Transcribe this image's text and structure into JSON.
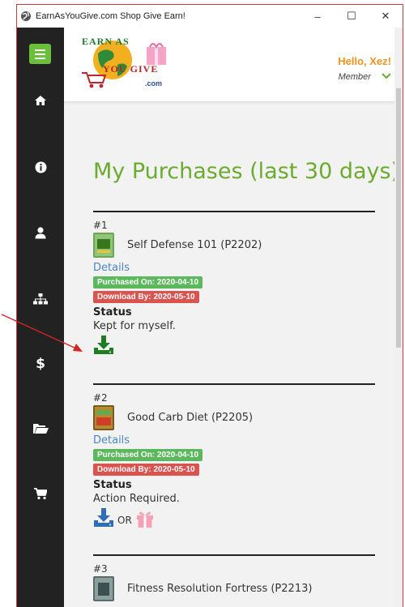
{
  "window": {
    "title": "EarnAsYouGive.com Shop Give Earn!",
    "minimize": "–",
    "maximize": "☐",
    "close": "✕"
  },
  "header": {
    "logo_line1": "EARN AS",
    "logo_line2": "YOU GIVE",
    "logo_domain": ".com",
    "greeting": "Hello, Xez!",
    "role": "Member"
  },
  "page": {
    "title": "My Purchases (last 30 days)"
  },
  "purchases": [
    {
      "number": "#1",
      "name": "Self Defense 101 (P2202)",
      "details_label": "Details",
      "purchased_on": "Purchased On: 2020-04-10",
      "download_by": "Download By: 2020-05-10",
      "status_label": "Status",
      "status": "Kept for myself."
    },
    {
      "number": "#2",
      "name": "Good Carb Diet (P2205)",
      "details_label": "Details",
      "purchased_on": "Purchased On: 2020-04-10",
      "download_by": "Download By: 2020-05-10",
      "status_label": "Status",
      "status": "Action Required.",
      "or_label": "OR"
    },
    {
      "number": "#3",
      "name": "Fitness Resolution Fortress (P2213)"
    }
  ],
  "colors": {
    "accent_green": "#6bab2e",
    "menu_green": "#6bbf3a",
    "greeting_orange": "#f0921c",
    "link_blue": "#4a86c5",
    "badge_green": "#5cb85c",
    "badge_red": "#d9534f",
    "annotation_red": "#d62424",
    "sidebar_bg": "#222222"
  },
  "sidebar": {
    "icons": [
      "menu-icon",
      "home-icon",
      "info-icon",
      "user-icon",
      "sitemap-icon",
      "dollar-icon",
      "folder-open-icon",
      "cart-icon"
    ]
  }
}
